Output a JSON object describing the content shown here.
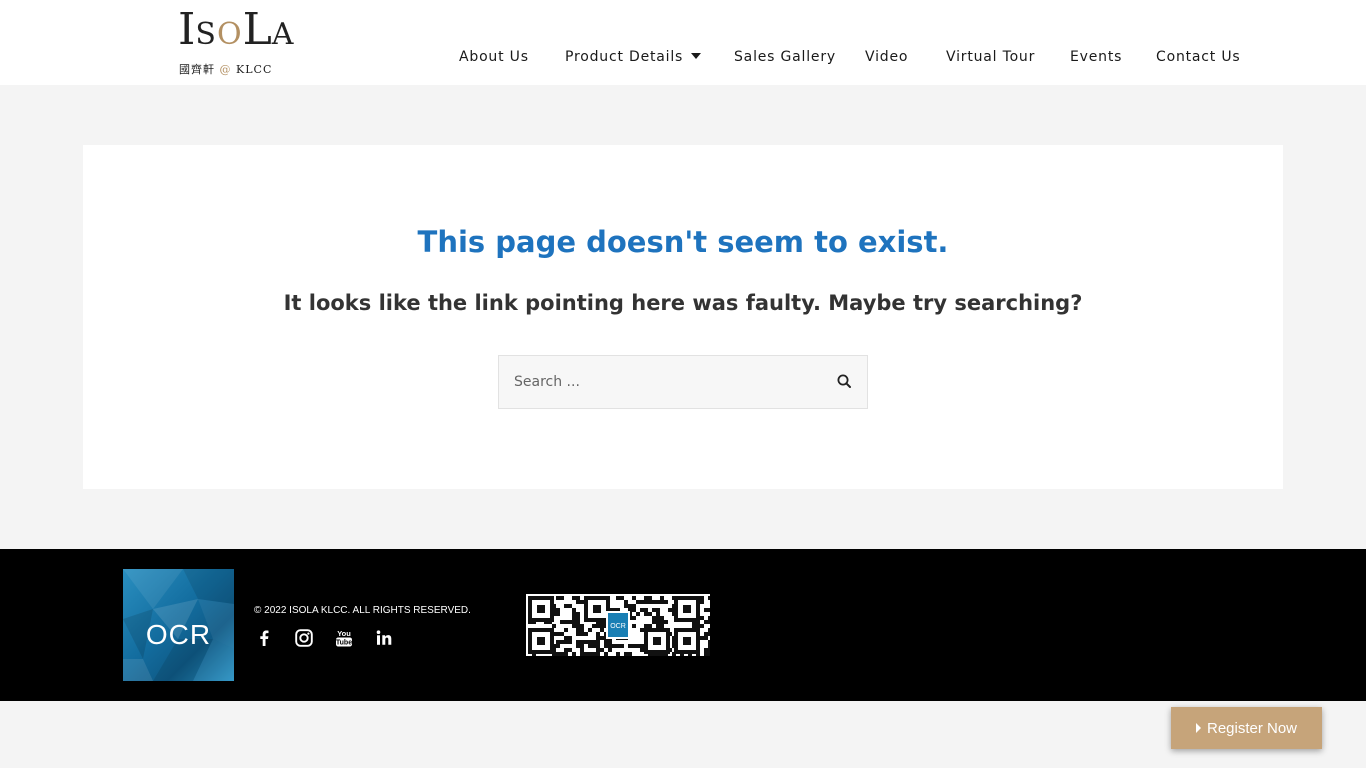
{
  "header": {
    "logo": {
      "letter_1": "I",
      "letter_2": "S",
      "letter_3": "O",
      "letter_4": "L",
      "letter_5": "A",
      "subtitle_cjk": "國齊軒",
      "subtitle_at": "@",
      "subtitle_latin": "KLCC"
    },
    "nav": [
      {
        "label": "About Us"
      },
      {
        "label": "Product Details",
        "has_dropdown": true
      },
      {
        "label": "Sales Gallery"
      },
      {
        "label": "Video"
      },
      {
        "label": "Virtual Tour"
      },
      {
        "label": "Events"
      },
      {
        "label": "Contact Us"
      }
    ]
  },
  "error": {
    "title": "This page doesn't seem to exist.",
    "subtitle": "It looks like the link pointing here was faulty. Maybe try searching?"
  },
  "search": {
    "placeholder": "Search ...",
    "value": "",
    "icon": "search-icon"
  },
  "footer": {
    "brand_logo_text": "OCR",
    "copyright": "© 2022 ISOLA KLCC. ALL RIGHTS RESERVED.",
    "social": [
      {
        "name": "facebook-icon"
      },
      {
        "name": "instagram-icon"
      },
      {
        "name": "youtube-icon"
      },
      {
        "name": "linkedin-icon"
      }
    ],
    "qr_badge_text": "OCR"
  },
  "register_button": {
    "label": "Register Now",
    "icon": "caret-right-icon"
  },
  "colors": {
    "link_blue": "#1e73be",
    "gold": "#c6a47a",
    "footer_bg": "#000000",
    "page_bg": "#f4f4f4"
  }
}
